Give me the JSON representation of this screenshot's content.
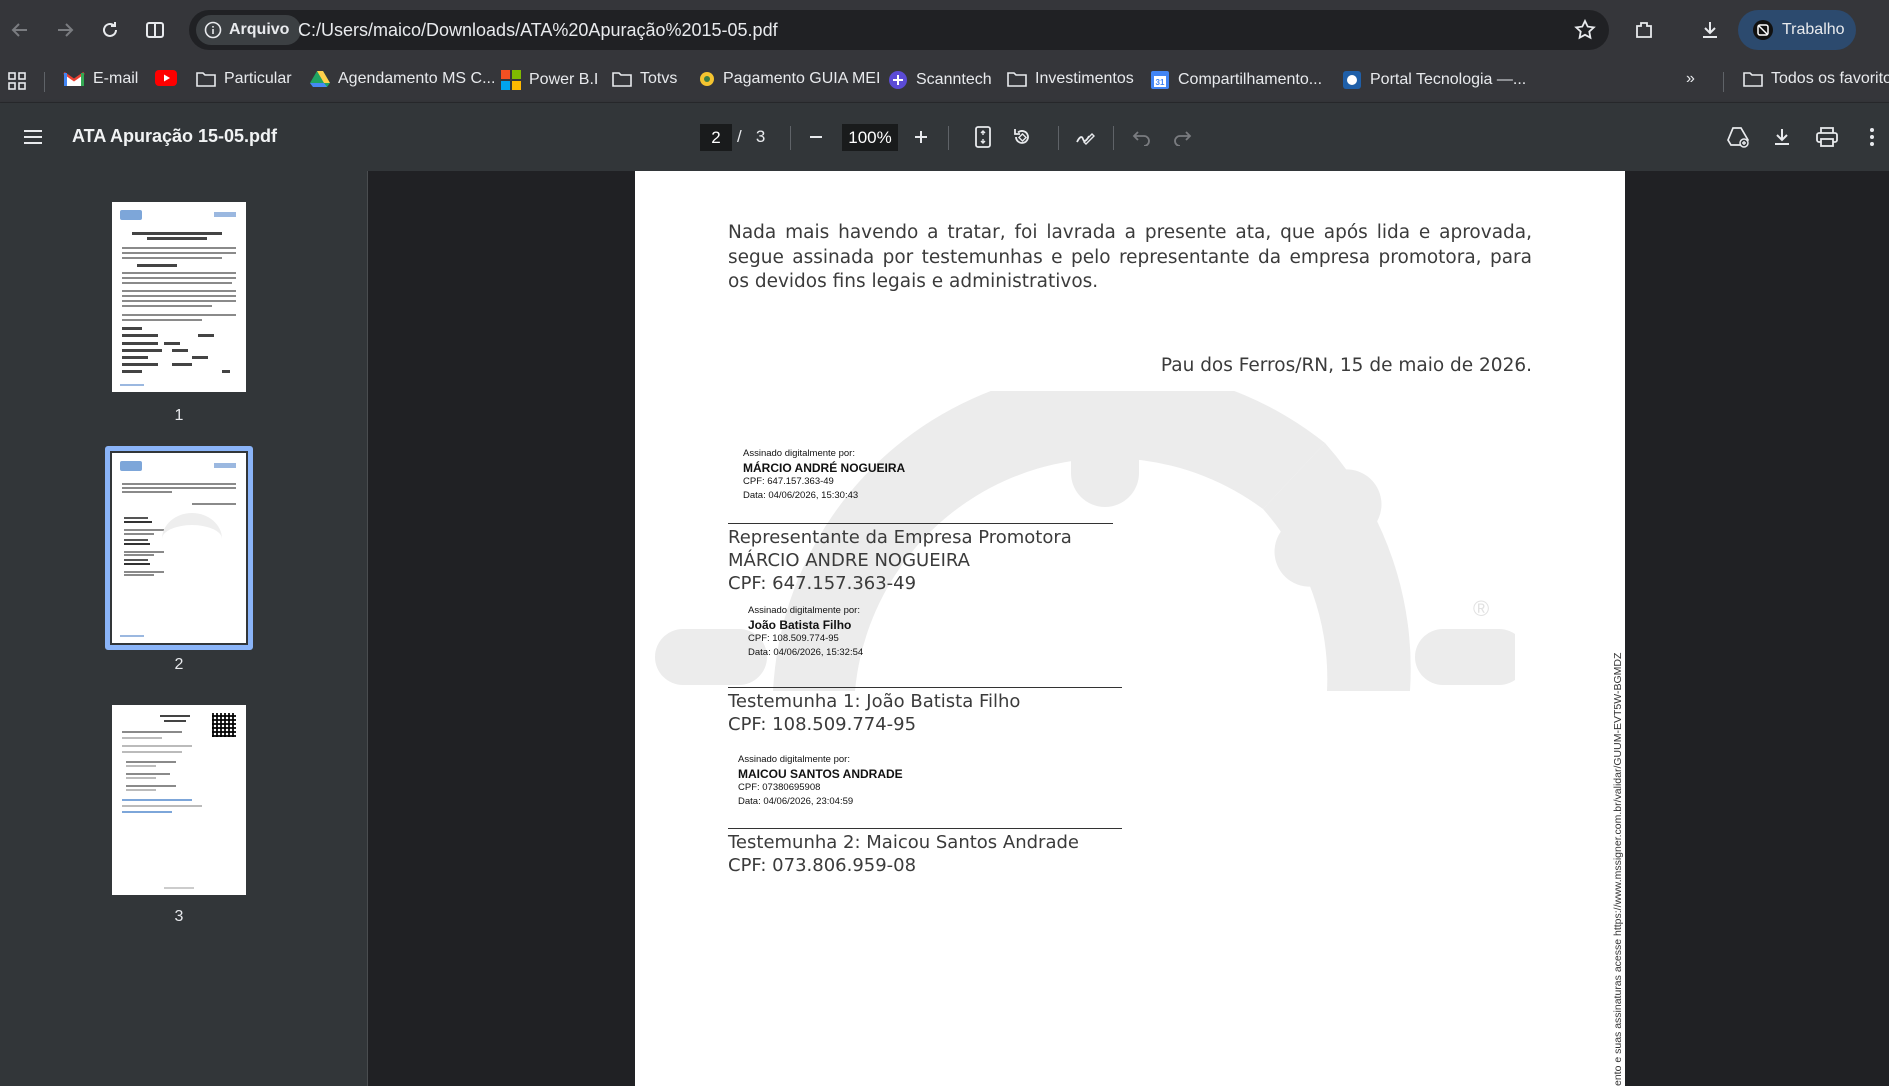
{
  "browser": {
    "security_chip": "Arquivo",
    "url": "C:/Users/maico/Downloads/ATA%20Apuração%2015-05.pdf",
    "profile_label": "Trabalho"
  },
  "bookmarks": {
    "items": [
      {
        "label": "E-mail",
        "icon": "gmail-icon"
      },
      {
        "label": "",
        "icon": "youtube-icon"
      },
      {
        "label": "Particular",
        "icon": "folder-icon"
      },
      {
        "label": "Agendamento MS C...",
        "icon": "drive-icon"
      },
      {
        "label": "Power B.I",
        "icon": "microsoft-icon"
      },
      {
        "label": "Totvs",
        "icon": "folder-icon"
      },
      {
        "label": "Pagamento GUIA MEI",
        "icon": "site-icon"
      },
      {
        "label": "Scanntech",
        "icon": "scanntech-icon"
      },
      {
        "label": "Investimentos",
        "icon": "folder-icon"
      },
      {
        "label": "Compartilhamento...",
        "icon": "calendar-icon"
      },
      {
        "label": "Portal Tecnologia —...",
        "icon": "portal-icon"
      }
    ],
    "overflow": "»",
    "all_bookmarks": "Todos os favoritos"
  },
  "pdf_toolbar": {
    "title": "ATA Apuração 15-05.pdf",
    "current_page": "2",
    "page_separator": "/",
    "total_pages": "3",
    "zoom": "100%"
  },
  "sidebar": {
    "thumbnails": [
      {
        "label": "1",
        "selected": false
      },
      {
        "label": "2",
        "selected": true
      },
      {
        "label": "3",
        "selected": false
      }
    ]
  },
  "document": {
    "paragraph": "Nada mais havendo a tratar, foi lavrada a presente ata, que após lida e aprovada, segue assinada por testemunhas e pelo representante da empresa promotora, para os devidos fins legais e administrativos.",
    "place_date": "Pau dos Ferros/RN, 15 de maio de 2026.",
    "signatures": [
      {
        "stamp_heading": "Assinado digitalmente por:",
        "stamp_name": "MÁRCIO ANDRÉ NOGUEIRA",
        "stamp_cpf": "CPF: 647.157.363-49",
        "stamp_date": "Data: 04/06/2026, 15:30:43",
        "role": "Representante da Empresa Promotora",
        "name": "MÁRCIO ANDRE NOGUEIRA",
        "cpf": "CPF: 647.157.363-49"
      },
      {
        "stamp_heading": "Assinado digitalmente por:",
        "stamp_name": "João Batista Filho",
        "stamp_cpf": "CPF: 108.509.774-95",
        "stamp_date": "Data: 04/06/2026, 15:32:54",
        "role": "Testemunha 1: João Batista Filho",
        "cpf": "CPF: 108.509.774-95"
      },
      {
        "stamp_heading": "Assinado digitalmente por:",
        "stamp_name": "MAICOU SANTOS ANDRADE",
        "stamp_cpf": "CPF: 07380695908",
        "stamp_date": "Data: 04/06/2026, 23:04:59",
        "role": "Testemunha 2: Maicou Santos Andrade",
        "cpf": "CPF: 073.806.959-08"
      }
    ],
    "vertical_note": "ento e suas assinaturas acesse https://www.mssigner.com.br/validar/GUUM-EVT5W-BGMDZ",
    "watermark_mark": "®"
  },
  "colors": {
    "accent": "#8ab4f8",
    "chrome_bg": "#35363a",
    "viewer_bg": "#202124",
    "toolbar_bg": "#323639"
  }
}
